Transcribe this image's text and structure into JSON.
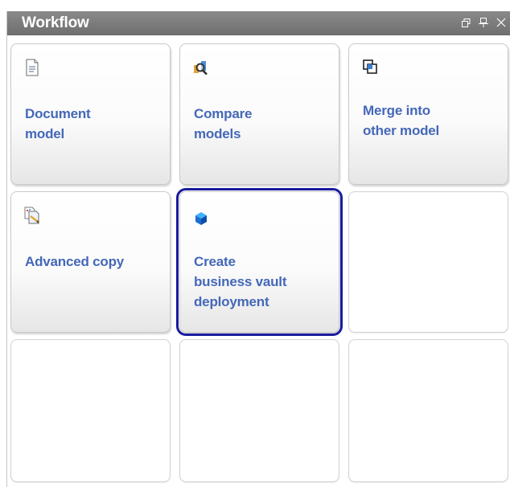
{
  "panel": {
    "title": "Workflow",
    "buttons": [
      {
        "name": "restore-window",
        "glyph": "🗗",
        "icon": "restore-icon"
      },
      {
        "name": "pin",
        "glyph": "⊥",
        "icon": "pin-icon"
      },
      {
        "name": "close",
        "glyph": "✕",
        "icon": "close-icon"
      }
    ]
  },
  "tiles": [
    {
      "label_line1": "Document",
      "label_line2": "model",
      "label_line3": "",
      "icon": "document-icon"
    },
    {
      "label_line1": "Compare",
      "label_line2": "models",
      "label_line3": "",
      "icon": "compare-magnifier-icon"
    },
    {
      "label_line1": "Merge into",
      "label_line2": "other model",
      "label_line3": "",
      "icon": "merge-icon"
    },
    {
      "label_line1": "Advanced copy",
      "label_line2": "",
      "label_line3": "",
      "icon": "advanced-copy-icon"
    },
    {
      "label_line1": "Create",
      "label_line2": "business vault",
      "label_line3": "deployment",
      "icon": "blue-cube-icon",
      "selected": true
    }
  ]
}
